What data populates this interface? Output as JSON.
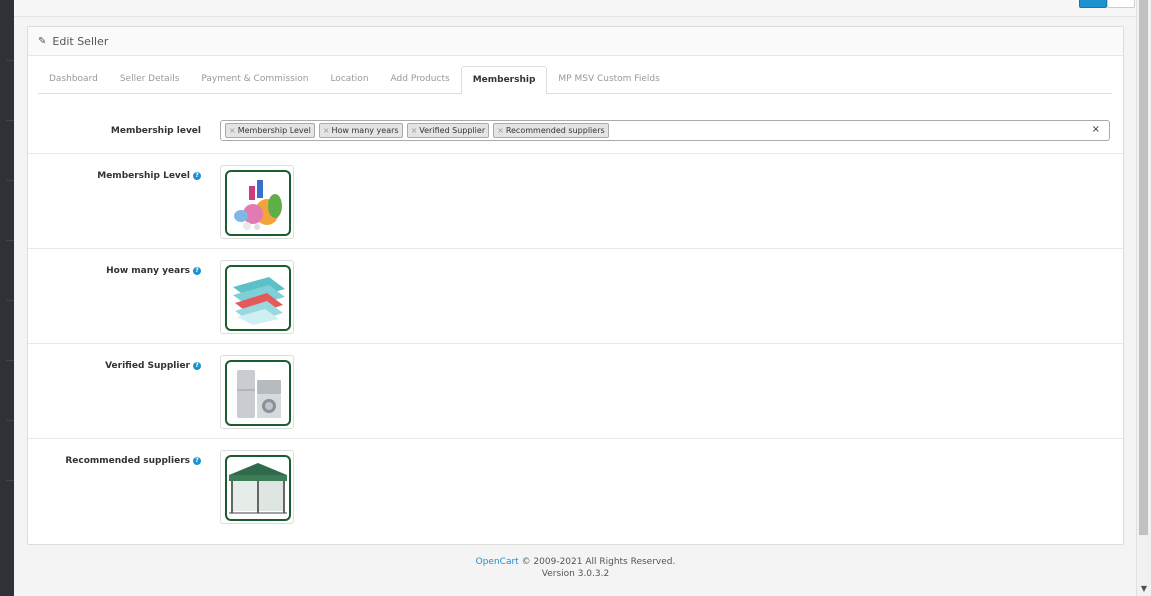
{
  "panel": {
    "title": "Edit Seller",
    "icon": "pencil-icon"
  },
  "tabs": [
    {
      "label": "Dashboard"
    },
    {
      "label": "Seller Details"
    },
    {
      "label": "Payment & Commission"
    },
    {
      "label": "Location"
    },
    {
      "label": "Add Products"
    },
    {
      "label": "Membership",
      "active": true
    },
    {
      "label": "MP MSV Custom Fields"
    }
  ],
  "membership": {
    "label": "Membership level",
    "selected": [
      "Membership Level",
      "How many years",
      "Verified Supplier",
      "Recommended suppliers"
    ],
    "chip_remove": "×",
    "clear": "×"
  },
  "fields": [
    {
      "label": "Membership Level",
      "image": "cleaning-supplies-image"
    },
    {
      "label": "How many years",
      "image": "polycarbonate-sheets-image"
    },
    {
      "label": "Verified Supplier",
      "image": "home-appliances-image"
    },
    {
      "label": "Recommended suppliers",
      "image": "gazebo-tent-image"
    }
  ],
  "help_icon": "?",
  "footer": {
    "link": "OpenCart",
    "copyright": " © 2009-2021 All Rights Reserved.",
    "version": "Version 3.0.3.2"
  },
  "colors": {
    "accent": "#1e91cf",
    "frame": "#1d5c2e"
  }
}
